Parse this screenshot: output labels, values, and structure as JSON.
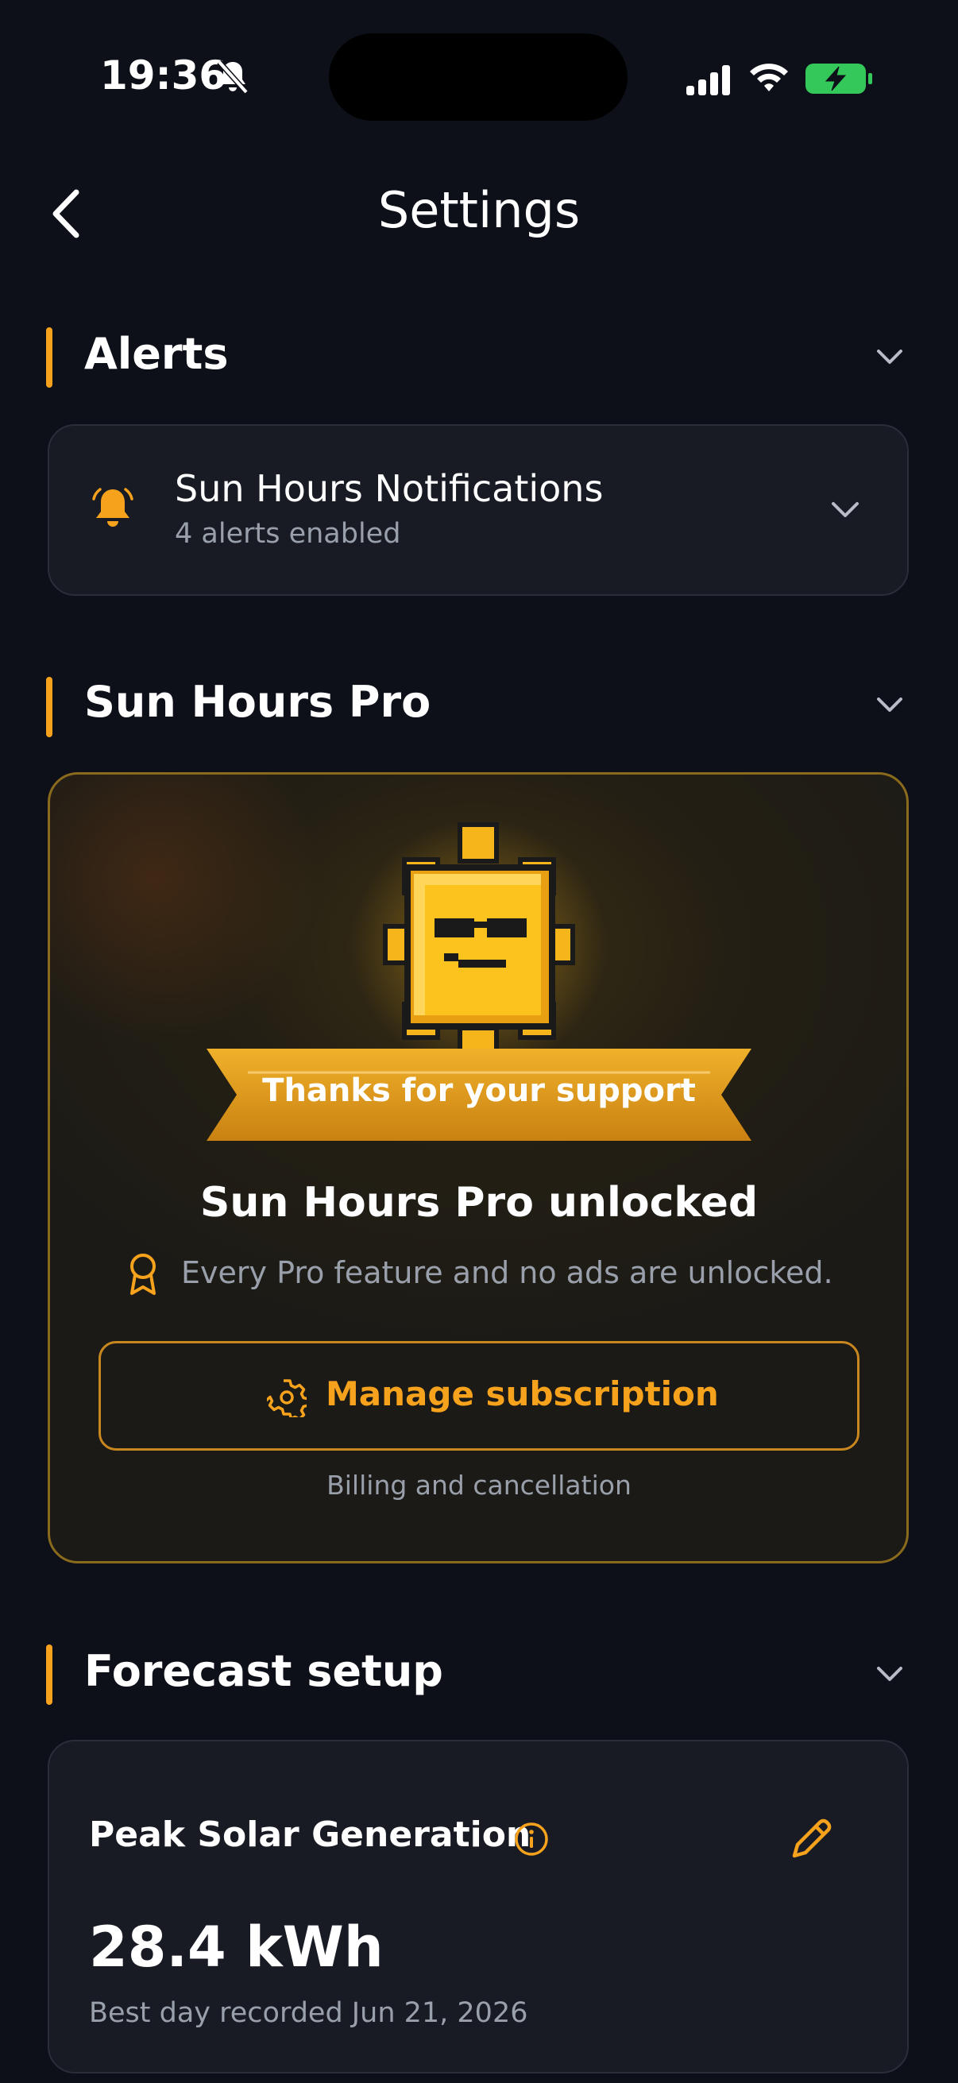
{
  "status_bar": {
    "time": "19:36",
    "icons": [
      "bell-slash-icon",
      "cellular-signal-icon",
      "wifi-icon",
      "battery-charging-icon"
    ]
  },
  "nav": {
    "title": "Settings",
    "back_icon": "chevron-left-icon"
  },
  "sections": {
    "alerts": {
      "title": "Alerts",
      "notifications": {
        "title": "Sun Hours Notifications",
        "subtitle": "4 alerts enabled",
        "icon": "bell-icon"
      }
    },
    "pro": {
      "title": "Sun Hours Pro",
      "ribbon": "Thanks for your support",
      "headline": "Sun Hours Pro unlocked",
      "description": "Every Pro feature and no ads are unlocked.",
      "manage_button": "Manage subscription",
      "billing_note": "Billing and cancellation"
    },
    "forecast": {
      "title": "Forecast setup",
      "peak": {
        "title": "Peak Solar Generation",
        "value": "28.4 kWh",
        "subtitle": "Best day recorded Jun 21, 2026"
      }
    }
  },
  "colors": {
    "background": "#0d1018",
    "accent": "#f7a21c",
    "card": "#181b24",
    "muted_text": "#9aa0ab",
    "battery": "#34c759"
  }
}
